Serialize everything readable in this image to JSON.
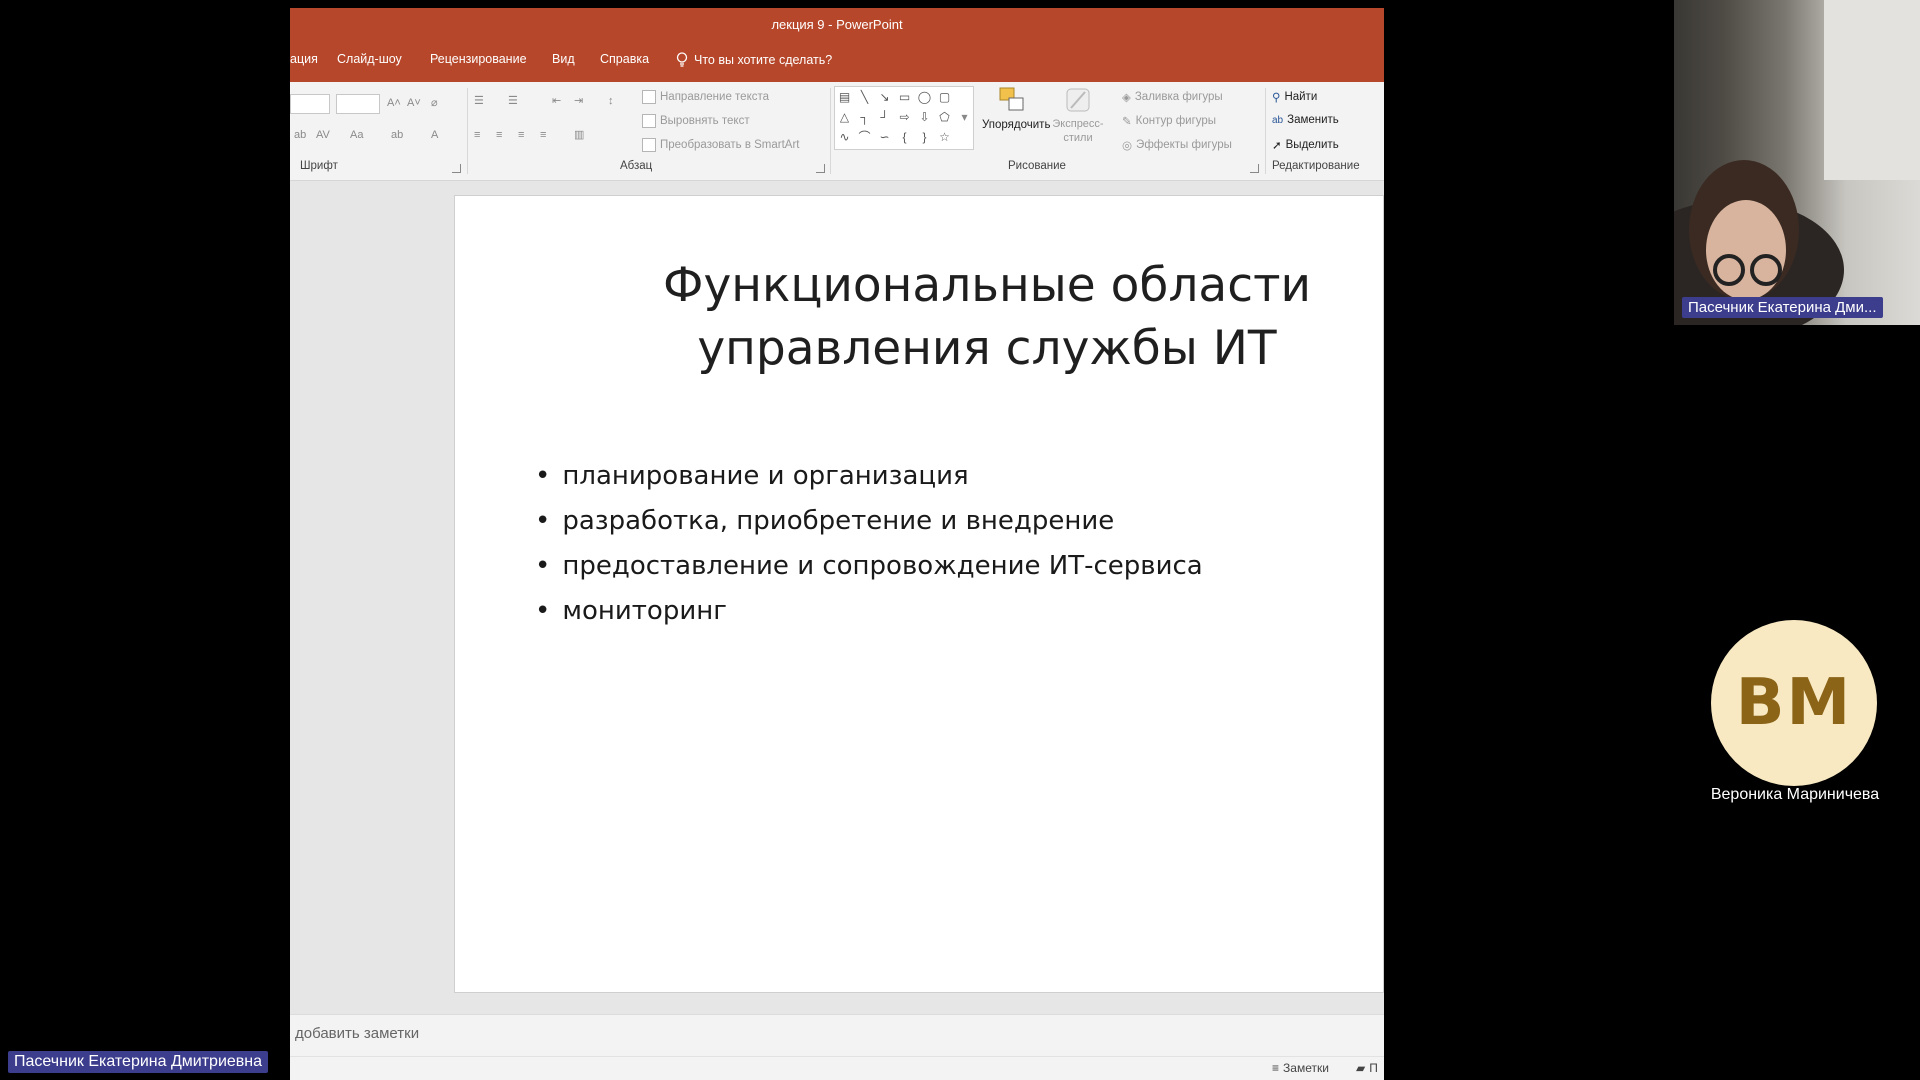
{
  "window": {
    "title": "лекция 9  -  PowerPoint"
  },
  "ribbon_tabs": [
    {
      "label": "ация"
    },
    {
      "label": "Слайд-шоу"
    },
    {
      "label": "Рецензирование"
    },
    {
      "label": "Вид"
    },
    {
      "label": "Справка"
    }
  ],
  "tell_me": "Что вы хотите сделать?",
  "ribbon": {
    "groups": {
      "font": "Шрифт",
      "paragraph": "Абзац",
      "drawing": "Рисование",
      "editing": "Редактирование"
    },
    "paragraph_buttons": {
      "text_direction": "Направление текста",
      "align_text": "Выровнять текст",
      "convert_smartart": "Преобразовать в SmartArt"
    },
    "drawing_buttons": {
      "arrange": "Упорядочить",
      "quick_styles": "Экспресс-стили",
      "shape_fill": "Заливка фигуры",
      "shape_outline": "Контур фигуры",
      "shape_effects": "Эффекты фигуры"
    },
    "editing_buttons": {
      "find": "Найти",
      "replace": "Заменить",
      "select": "Выделить"
    }
  },
  "slide": {
    "title_line1": "Функциональные области",
    "title_line2": "управления службы ИТ",
    "bullets": [
      "планирование и организация",
      "разработка, приобретение и внедрение",
      "предоставление и сопровождение ИТ-сервиса",
      "мониторинг"
    ]
  },
  "notes_placeholder": "добавить заметки",
  "statusbar": {
    "notes": "Заметки",
    "comments": "П"
  },
  "participants": {
    "presenter_tag": "Пасечник Екатерина Дмитриевна",
    "webcam_tag": "Пасечник Екатерина Дми...",
    "other_initials": "ВМ",
    "other_name": "Вероника Мариничева"
  },
  "colors": {
    "ppt_accent": "#b7472a",
    "name_tag_bg": "#3c3d8c",
    "avatar_bg": "#f8e9c2"
  }
}
